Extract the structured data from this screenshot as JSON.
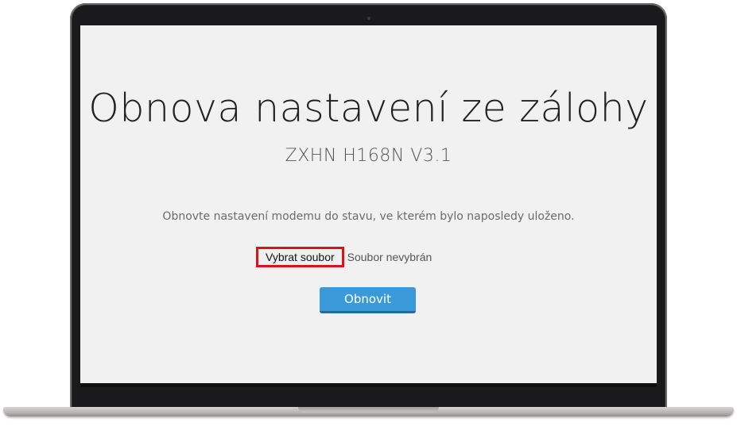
{
  "page": {
    "title": "Obnova nastavení ze zálohy",
    "subtitle": "ZXHN H168N V3.1",
    "description": "Obnovte nastavení modemu do stavu, ve kterém bylo naposledy uloženo."
  },
  "file_input": {
    "button_label": "Vybrat soubor",
    "status_text": "Soubor nevybrán",
    "highlight_color": "#d6141a"
  },
  "actions": {
    "submit_label": "Obnovit",
    "submit_color": "#3a9ad9"
  },
  "device_frame": {
    "camera_icon": "webcam-dot"
  }
}
